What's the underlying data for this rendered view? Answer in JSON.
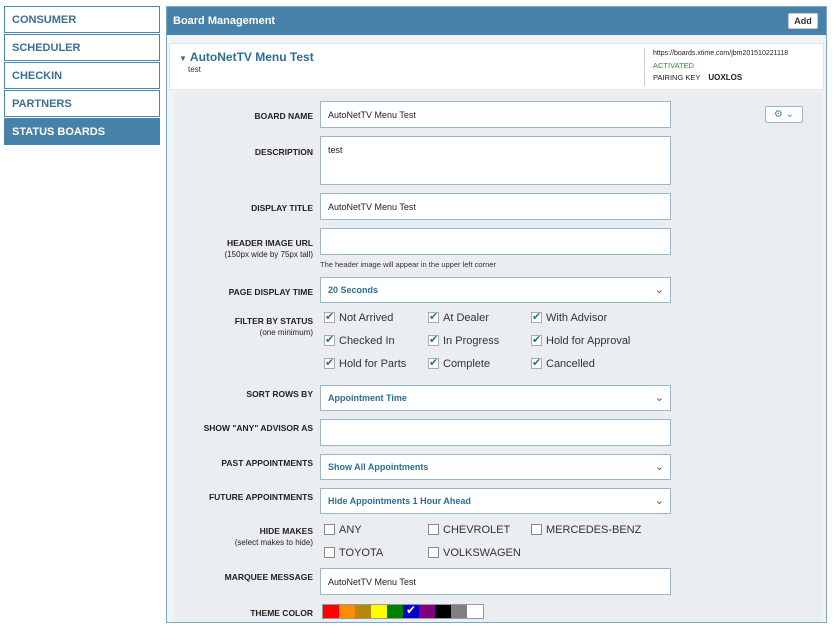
{
  "sidebar": {
    "items": [
      {
        "label": "CONSUMER"
      },
      {
        "label": "SCHEDULER"
      },
      {
        "label": "CHECKIN"
      },
      {
        "label": "PARTNERS"
      },
      {
        "label": "STATUS BOARDS"
      }
    ]
  },
  "panel": {
    "title": "Board Management",
    "add_label": "Add"
  },
  "board": {
    "title": "AutoNetTV Menu Test",
    "subtitle": "test",
    "url": "https://boards.xtime.com/jbm201510221118",
    "status": "ACTIVATED",
    "pairing_label": "PAIRING KEY",
    "pairing_key": "UOXLOS"
  },
  "form": {
    "board_name": {
      "label": "BOARD NAME",
      "value": "AutoNetTV Menu Test"
    },
    "description": {
      "label": "DESCRIPTION",
      "value": "test"
    },
    "display_title": {
      "label": "DISPLAY TITLE",
      "value": "AutoNetTV Menu Test"
    },
    "header_image": {
      "label": "HEADER IMAGE URL",
      "sub": "(150px wide by 75px tall)",
      "value": "",
      "hint": "The header image will appear in the upper left corner"
    },
    "page_display_time": {
      "label": "PAGE DISPLAY TIME",
      "value": "20 Seconds"
    },
    "filter_by_status": {
      "label": "FILTER BY STATUS",
      "sub": "(one minimum)",
      "options": [
        {
          "label": "Not Arrived",
          "checked": true
        },
        {
          "label": "At Dealer",
          "checked": true
        },
        {
          "label": "With Advisor",
          "checked": true
        },
        {
          "label": "Checked In",
          "checked": true
        },
        {
          "label": "In Progress",
          "checked": true
        },
        {
          "label": "Hold for Approval",
          "checked": true
        },
        {
          "label": "Hold for Parts",
          "checked": true
        },
        {
          "label": "Complete",
          "checked": true
        },
        {
          "label": "Cancelled",
          "checked": true
        }
      ]
    },
    "sort_rows_by": {
      "label": "SORT ROWS BY",
      "value": "Appointment Time"
    },
    "show_any_advisor": {
      "label": "SHOW \"ANY\" ADVISOR AS",
      "value": ""
    },
    "past_appointments": {
      "label": "PAST APPOINTMENTS",
      "value": "Show All Appointments"
    },
    "future_appointments": {
      "label": "FUTURE APPOINTMENTS",
      "value": "Hide Appointments 1 Hour Ahead"
    },
    "hide_makes": {
      "label": "HIDE MAKES",
      "sub": "(select makes to hide)",
      "options": [
        {
          "label": "ANY",
          "checked": false
        },
        {
          "label": "CHEVROLET",
          "checked": false
        },
        {
          "label": "MERCEDES-BENZ",
          "checked": false
        },
        {
          "label": "TOYOTA",
          "checked": false
        },
        {
          "label": "VOLKSWAGEN",
          "checked": false
        }
      ]
    },
    "marquee_message": {
      "label": "MARQUEE MESSAGE",
      "value": "AutoNetTV Menu Test"
    },
    "theme_color": {
      "label": "THEME COLOR",
      "colors": [
        "#ff0000",
        "#ff8c00",
        "#b8860b",
        "#ffff00",
        "#008000",
        "#0000cd",
        "#800080",
        "#000000",
        "#808080",
        "#ffffff"
      ],
      "selected_index": 5
    }
  },
  "icons": {
    "gear": "gear-icon",
    "chevron": "chevron-down-icon",
    "collapse": "triangle-down-icon"
  }
}
